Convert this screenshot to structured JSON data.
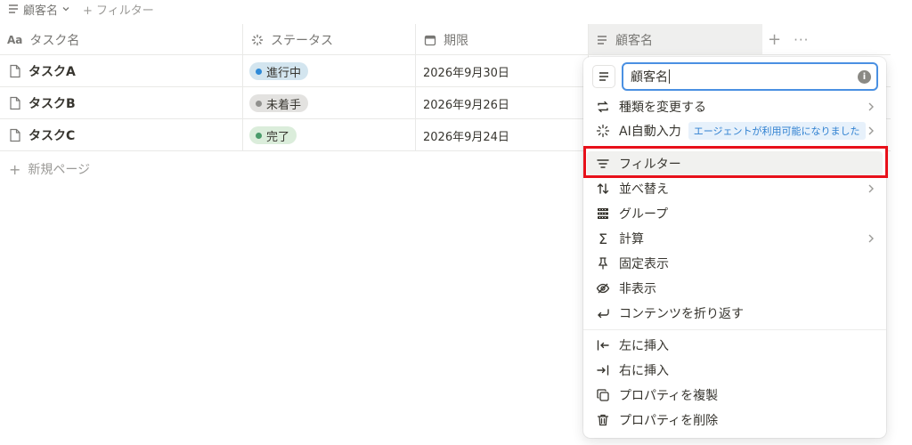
{
  "topbar": {
    "view_label": "顧客名",
    "filter_label": "+ フィルター"
  },
  "table": {
    "columns": [
      {
        "label": "タスク名"
      },
      {
        "label": "ステータス"
      },
      {
        "label": "期限"
      },
      {
        "label": "顧客名"
      }
    ],
    "rows": [
      {
        "name": "タスクA",
        "status": "進行中",
        "due": "2026年9月30日"
      },
      {
        "name": "タスクB",
        "status": "未着手",
        "due": "2026年9月26日"
      },
      {
        "name": "タスクC",
        "status": "完了",
        "due": "2026年9月24日"
      }
    ],
    "new_page_label": "新規ページ",
    "aa_label": "Aa"
  },
  "status_colors": {
    "in_progress": {
      "bg": "#d3e5ef",
      "dot": "#2e8ad8"
    },
    "not_started": {
      "bg": "#e3e2e0",
      "dot": "#91918e"
    },
    "done": {
      "bg": "#dbeddb",
      "dot": "#4a9b6a"
    }
  },
  "menu": {
    "name_value": "顧客名",
    "info_label": "i",
    "items": {
      "change_type": "種類を変更する",
      "ai_autofill": "AI自動入力",
      "ai_badge": "エージェントが利用可能になりました",
      "filter": "フィルター",
      "sort": "並べ替え",
      "group": "グループ",
      "calculate": "計算",
      "pin": "固定表示",
      "hide": "非表示",
      "wrap": "コンテンツを折り返す",
      "insert_left": "左に挿入",
      "insert_right": "右に挿入",
      "duplicate": "プロパティを複製",
      "delete": "プロパティを削除"
    }
  },
  "highlight_color": "#e8101a",
  "accent_color": "#4a90e2"
}
